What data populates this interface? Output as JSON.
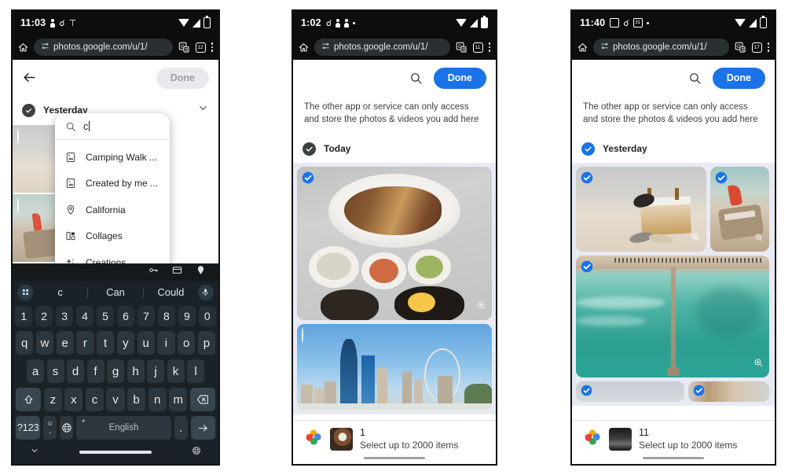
{
  "phones": [
    {
      "id": "phone-search",
      "status_bar": {
        "time": "11:03",
        "left_icons": [
          "person-icon",
          "gmail-icon",
          "antenna-icon"
        ],
        "right_icons": [
          "wifi-icon",
          "signal-icon",
          "battery-icon"
        ]
      },
      "browser": {
        "home_icon": "home-icon",
        "url": "photos.google.com/u/1/",
        "tune_icon": "tune-icon",
        "translate_icon": "translate-icon",
        "tabs_icon": "tabs-icon",
        "tabs_count": "12",
        "menu_icon": "kebab-menu-icon"
      },
      "app": {
        "back_icon": "back-arrow-icon",
        "done_label": "Done",
        "done_enabled": false,
        "search": {
          "icon": "search-icon",
          "value": "c",
          "placeholder": "Search",
          "suggestions": [
            {
              "label": "Camping Walk ...",
              "icon": "photo-album-icon"
            },
            {
              "label": "Created by me ...",
              "icon": "photo-album-icon"
            },
            {
              "label": "California",
              "icon": "location-pin-icon"
            },
            {
              "label": "Collages",
              "icon": "collage-icon"
            },
            {
              "label": "Creations",
              "icon": "sparkle-icon"
            }
          ]
        },
        "section": {
          "title": "Yesterday",
          "checked": true,
          "chevron": "chevron-down-icon"
        }
      },
      "keyboard": {
        "toolbar_icons": [
          "password-key-icon",
          "payment-card-icon",
          "location-pin-icon"
        ],
        "grid_icon": "app-grid-icon",
        "mic_icon": "microphone-icon",
        "suggestions": [
          "c",
          "Can",
          "Could"
        ],
        "rows": [
          [
            "1",
            "2",
            "3",
            "4",
            "5",
            "6",
            "7",
            "8",
            "9",
            "0"
          ],
          [
            "q",
            "w",
            "e",
            "r",
            "t",
            "y",
            "u",
            "i",
            "o",
            "p"
          ],
          [
            "a",
            "s",
            "d",
            "f",
            "g",
            "h",
            "j",
            "k",
            "l"
          ],
          [
            "z",
            "x",
            "c",
            "v",
            "b",
            "n",
            "m"
          ]
        ],
        "shift_icon": "shift-arrow-icon",
        "backspace_icon": "backspace-icon",
        "symbols_label": "?123",
        "emoji_label": ",",
        "globe_icon": "globe-icon",
        "space_label": "English",
        "space_sup_icon": "sticker-icon",
        "period_label": ".",
        "enter_icon": "enter-arrow-icon",
        "nav": {
          "hide_icon": "chevron-down-icon",
          "lang_icon": "globe-icon"
        }
      }
    },
    {
      "id": "phone-one-selected",
      "status_bar": {
        "time": "1:02",
        "left_icons": [
          "gmail-icon",
          "person-icon",
          "person-icon",
          "dot-icon"
        ],
        "right_icons": [
          "wifi-icon",
          "signal-icon",
          "battery-icon"
        ]
      },
      "browser": {
        "home_icon": "home-icon",
        "url": "photos.google.com/u/1/",
        "tune_icon": "tune-icon",
        "translate_icon": "translate-icon",
        "tabs_icon": "tabs-icon",
        "tabs_count": "11",
        "menu_icon": "kebab-menu-icon"
      },
      "app": {
        "search_icon": "search-icon",
        "done_label": "Done",
        "done_enabled": true,
        "notice": "The other app or service can only access and store the photos & videos you add here",
        "section": {
          "title": "Today",
          "checked": true
        },
        "photos": [
          {
            "name": "korean-food-platter",
            "selected": true,
            "zoom_icon": "zoom-in-icon"
          },
          {
            "name": "city-skyline-ferris-wheel",
            "selected": false
          }
        ]
      },
      "sheet": {
        "logo_icon": "google-photos-logo",
        "thumbnail": "korean-food-thumbnail",
        "count": "1",
        "limit_label": "Select up to 2000 items"
      }
    },
    {
      "id": "phone-eleven-selected",
      "status_bar": {
        "time": "11:40",
        "left_icons": [
          "chat-icon",
          "gmail-icon",
          "calendar-icon",
          "dot-icon"
        ],
        "right_icons": [
          "wifi-icon",
          "signal-icon",
          "battery-icon"
        ]
      },
      "browser": {
        "home_icon": "home-icon",
        "url": "photos.google.com/u/1/",
        "tune_icon": "tune-icon",
        "translate_icon": "translate-icon",
        "tabs_icon": "tabs-icon",
        "tabs_count": "17",
        "menu_icon": "kebab-menu-icon"
      },
      "app": {
        "search_icon": "search-icon",
        "done_label": "Done",
        "done_enabled": true,
        "notice": "The other app or service can only access and store the photos & videos you add here",
        "section": {
          "title": "Yesterday",
          "checked": true
        },
        "photos": [
          {
            "name": "beach-bag-sandals",
            "selected": true,
            "zoom_icon": "zoom-in-icon"
          },
          {
            "name": "beach-umbrella-driftwood",
            "selected": true,
            "zoom_icon": "zoom-in-icon"
          },
          {
            "name": "aerial-pier-turquoise-sea",
            "selected": true,
            "zoom_icon": "zoom-in-icon"
          },
          {
            "name": "partial-photo-left",
            "selected": true
          },
          {
            "name": "partial-photo-right",
            "selected": true
          }
        ]
      },
      "sheet": {
        "logo_icon": "google-photos-logo",
        "thumbnail": "cityscape-thumbnail",
        "count": "11",
        "limit_label": "Select up to 2000 items"
      }
    }
  ],
  "colors": {
    "accent_blue": "#1a73e8",
    "status_bar": "#0d0d0d",
    "grid_bg": "#e8eaf3",
    "keyboard_bg": "#1b2227",
    "key_bg": "#2c363c",
    "disabled_button": "#e8eaed"
  }
}
